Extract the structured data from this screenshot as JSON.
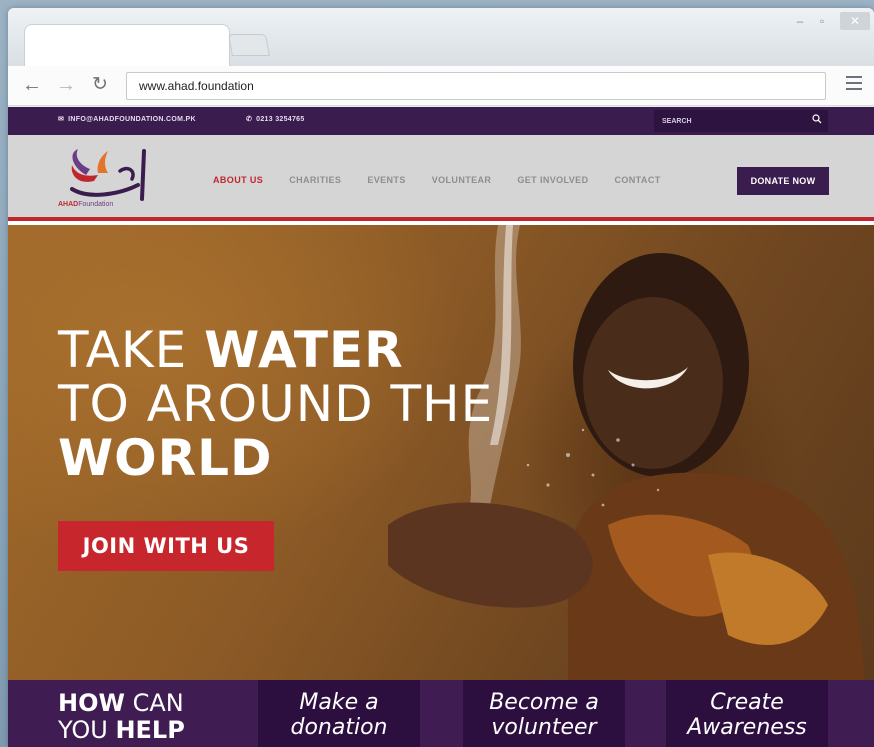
{
  "browser": {
    "url": "www.ahad.foundation",
    "window_controls": {
      "minimize": "–",
      "maximize": "▫",
      "close": "✕"
    }
  },
  "topbar": {
    "email": "INFO@AHADFOUNDATION.COM.PK",
    "phone": "0213 3254765",
    "search_placeholder": "SEARCH"
  },
  "logo": {
    "name": "AHAD",
    "suffix": "Foundation"
  },
  "nav": {
    "items": [
      {
        "label": "ABOUT US",
        "active": true
      },
      {
        "label": "CHARITIES",
        "active": false
      },
      {
        "label": "EVENTS",
        "active": false
      },
      {
        "label": "VOLUNTEAR",
        "active": false
      },
      {
        "label": "GET INVOLVED",
        "active": false
      },
      {
        "label": "CONTACT",
        "active": false
      }
    ],
    "donate_label": "DONATE NOW"
  },
  "hero": {
    "line1_thin": "TAKE ",
    "line1_bold": "WATER",
    "line2_thin": "TO AROUND THE",
    "line3_bold": "WORLD",
    "cta_label": "JOIN WITH US"
  },
  "help": {
    "title_bold_1": "HOW",
    "title_thin_1": " CAN",
    "title_thin_2": "YOU ",
    "title_bold_2": "HELP",
    "cards": [
      {
        "line1": "Make a",
        "line2": "donation"
      },
      {
        "line1": "Become a",
        "line2": "volunteer"
      },
      {
        "line1": "Create",
        "line2": "Awareness"
      }
    ]
  },
  "colors": {
    "brand_purple": "#3a1c4f",
    "accent_red": "#c0272d",
    "card_purple": "#2d0f3f"
  }
}
